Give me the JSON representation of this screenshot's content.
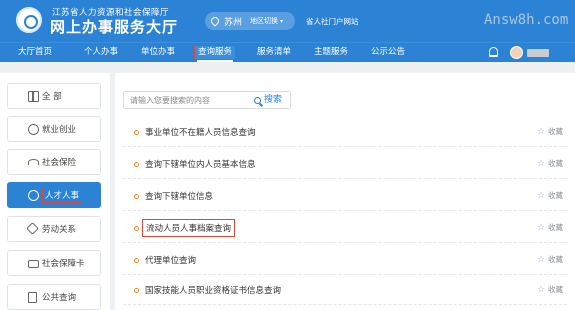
{
  "header": {
    "org_name": "江苏省人力资源和社会保障厅",
    "hall_title": "网上办事服务大厅",
    "city": "苏州",
    "region_switch": "地区切换",
    "portal_link": "省人社门户网站",
    "watermark": "Answ8h.com"
  },
  "nav": {
    "items": [
      {
        "label": "大厅首页"
      },
      {
        "label": "个人办事"
      },
      {
        "label": "单位办事"
      },
      {
        "label": "查询服务"
      },
      {
        "label": "服务清单"
      },
      {
        "label": "主题服务"
      },
      {
        "label": "公示公告"
      }
    ],
    "active_index": 3
  },
  "sidebar": {
    "items": [
      {
        "label": "全 部",
        "icon": "grid-icon"
      },
      {
        "label": "就业创业",
        "icon": "badge-icon"
      },
      {
        "label": "社会保险",
        "icon": "umbrella-icon"
      },
      {
        "label": "人才人事",
        "icon": "people-icon"
      },
      {
        "label": "劳动关系",
        "icon": "tool-icon"
      },
      {
        "label": "社会保障卡",
        "icon": "card-icon"
      },
      {
        "label": "公共查询",
        "icon": "doc-icon"
      }
    ],
    "active_index": 3
  },
  "search": {
    "placeholder": "请输入您要搜索的内容",
    "button_label": "搜索"
  },
  "list": {
    "fav_label": "收藏",
    "items": [
      {
        "title": "事业单位不在籍人员信息查询"
      },
      {
        "title": "查询下辖单位内人员基本信息"
      },
      {
        "title": "查询下辖单位信息"
      },
      {
        "title": "流动人员人事档案查询"
      },
      {
        "title": "代理单位查询"
      },
      {
        "title": "国家技能人员职业资格证书信息查询"
      }
    ],
    "highlighted_index": 3
  },
  "colors": {
    "primary": "#2c83d6",
    "highlight_border": "#e0453a",
    "bullet": "#f08a2e"
  }
}
